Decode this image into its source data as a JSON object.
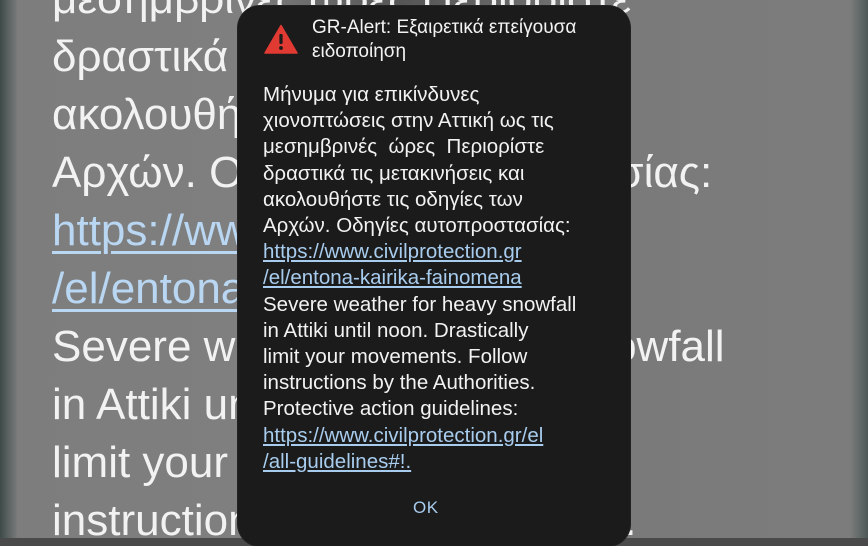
{
  "background_lines": [
    {
      "text": "μεσημβρινές ώρες Περιορίστε",
      "link": false
    },
    {
      "text": "δραστικά τις μετακινήσεις και",
      "link": false
    },
    {
      "text": "ακολουθήστε τις οδηγίες των",
      "link": false
    },
    {
      "text": "Αρχών. Οδηγίες αυτοπροστασίας:",
      "link": false
    },
    {
      "text": "https://www.civilprotection.gr",
      "link": true
    },
    {
      "text": "/el/entona-kairika-fainomena",
      "link": true
    },
    {
      "text": "Severe weather for heavy snowfall",
      "link": false
    },
    {
      "text": "in Attiki until noon. Drastically",
      "link": false
    },
    {
      "text": "limit your movements. Follow",
      "link": false
    },
    {
      "text": "instructions by the Authorities.",
      "link": false
    }
  ],
  "alert": {
    "icon": "warning-triangle-icon",
    "icon_color": "#e03a33",
    "title": "GR-Alert: Εξαιρετικά επείγουσα ειδοποίηση",
    "message_lines_el": [
      "Μήνυμα για επικίνδυνες",
      "χιονοπτώσεις στην Αττική ως τις",
      "μεσημβρινές  ώρες  Περιορίστε",
      "δραστικά τις μετακινήσεις και",
      "ακολουθήστε τις οδηγίες των",
      "Αρχών. Οδηγίες αυτοπροστασίας:"
    ],
    "link1_lines": [
      "https://www.civilprotection.gr",
      "/el/entona-kairika-fainomena"
    ],
    "message_lines_en": [
      "Severe weather for heavy snowfall",
      "in Attiki until noon. Drastically",
      "limit your movements. Follow",
      "instructions by the Authorities.",
      "Protective action guidelines:"
    ],
    "link2_lines": [
      "https://www.civilprotection.gr/el",
      "/all-guidelines#!."
    ],
    "ok_label": "OK",
    "link_color": "#a8ccee"
  }
}
